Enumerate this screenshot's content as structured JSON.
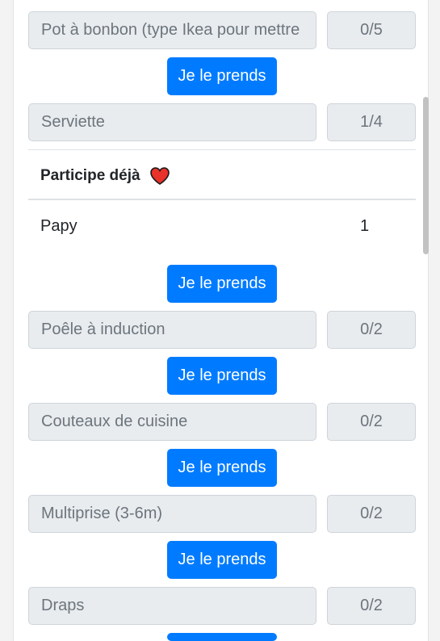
{
  "items": [
    {
      "name": "Pot à bonbon (type Ikea pour mettre",
      "count": "0/5"
    },
    {
      "name": "Serviette",
      "count": "1/4"
    },
    {
      "name": "Poêle à induction",
      "count": "0/2"
    },
    {
      "name": "Couteaux de cuisine",
      "count": "0/2"
    },
    {
      "name": "Multiprise (3-6m)",
      "count": "0/2"
    },
    {
      "name": "Draps",
      "count": "0/2"
    }
  ],
  "button_label": "Je le prends",
  "participants": {
    "heading": "Participe déjà",
    "rows": [
      {
        "name": "Papy",
        "count": "1"
      }
    ]
  },
  "colors": {
    "primary": "#007bff",
    "heart": "#e8322a"
  }
}
